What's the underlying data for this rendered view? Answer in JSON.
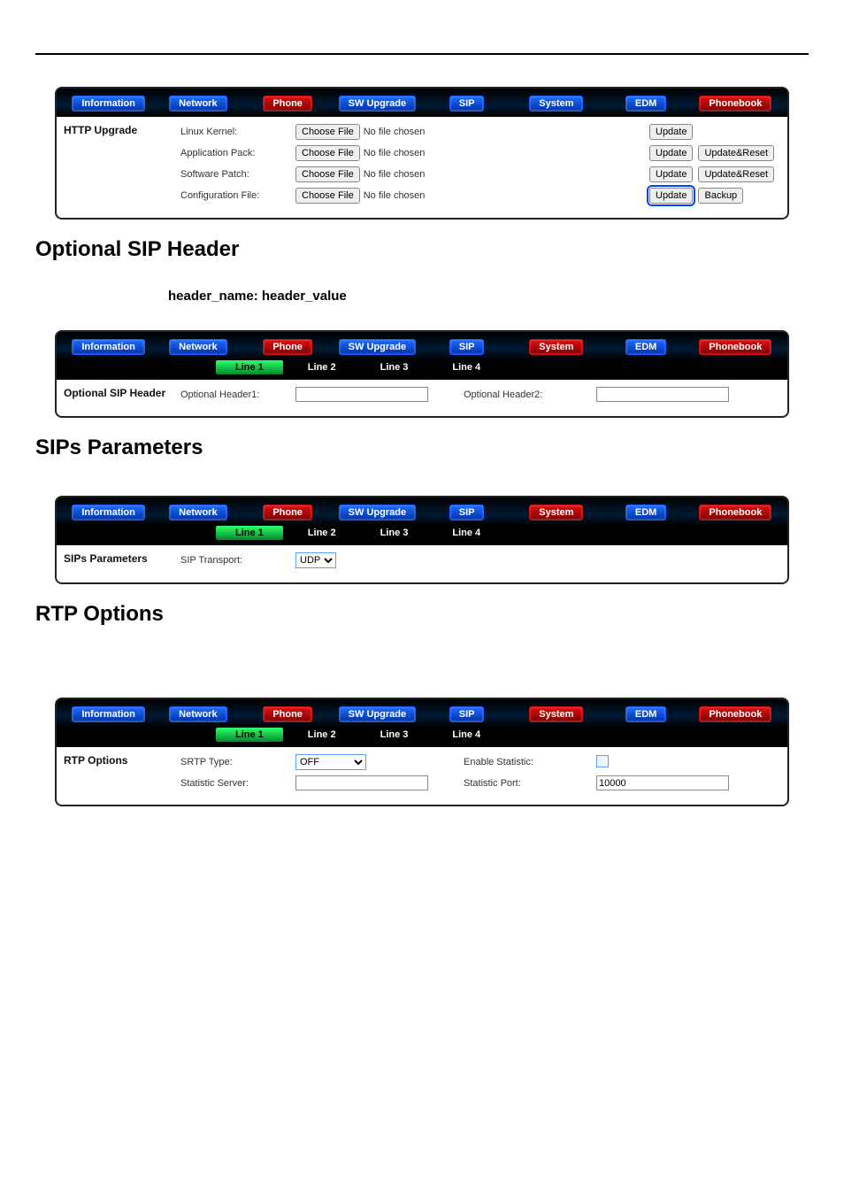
{
  "nav": {
    "information": "Information",
    "network": "Network",
    "phone": "Phone",
    "sw_upgrade": "SW Upgrade",
    "sip": "SIP",
    "system": "System",
    "edm": "EDM",
    "phonebook": "Phonebook"
  },
  "subtabs": {
    "line1": "Line 1",
    "line2": "Line 2",
    "line3": "Line 3",
    "line4": "Line 4"
  },
  "http_upgrade": {
    "title": "HTTP Upgrade",
    "rows": [
      {
        "label": "Linux Kernel:",
        "choose": "Choose File",
        "status": "No file chosen",
        "btn1": "Update",
        "btn2": ""
      },
      {
        "label": "Application Pack:",
        "choose": "Choose File",
        "status": "No file chosen",
        "btn1": "Update",
        "btn2": "Update&Reset"
      },
      {
        "label": "Software Patch:",
        "choose": "Choose File",
        "status": "No file chosen",
        "btn1": "Update",
        "btn2": "Update&Reset"
      },
      {
        "label": "Configuration File:",
        "choose": "Choose File",
        "status": "No file chosen",
        "btn1": "Update",
        "btn2": "Backup",
        "hl": true
      }
    ]
  },
  "headings": {
    "optional_sip": "Optional SIP Header",
    "sips_params": "SIPs Parameters",
    "rtp_options": "RTP Options"
  },
  "subline": "header_name: header_value",
  "optional_header": {
    "title": "Optional SIP Header",
    "h1_label": "Optional Header1:",
    "h1_value": "",
    "h2_label": "Optional Header2:",
    "h2_value": ""
  },
  "sips": {
    "title": "SIPs Parameters",
    "transport_label": "SIP Transport:",
    "transport_value": "UDP"
  },
  "rtp": {
    "title": "RTP Options",
    "srtp_label": "SRTP Type:",
    "srtp_value": "OFF",
    "stat_server_label": "Statistic Server:",
    "stat_server_value": "",
    "enable_stat_label": "Enable Statistic:",
    "enable_stat_checked": false,
    "stat_port_label": "Statistic Port:",
    "stat_port_value": "10000"
  }
}
